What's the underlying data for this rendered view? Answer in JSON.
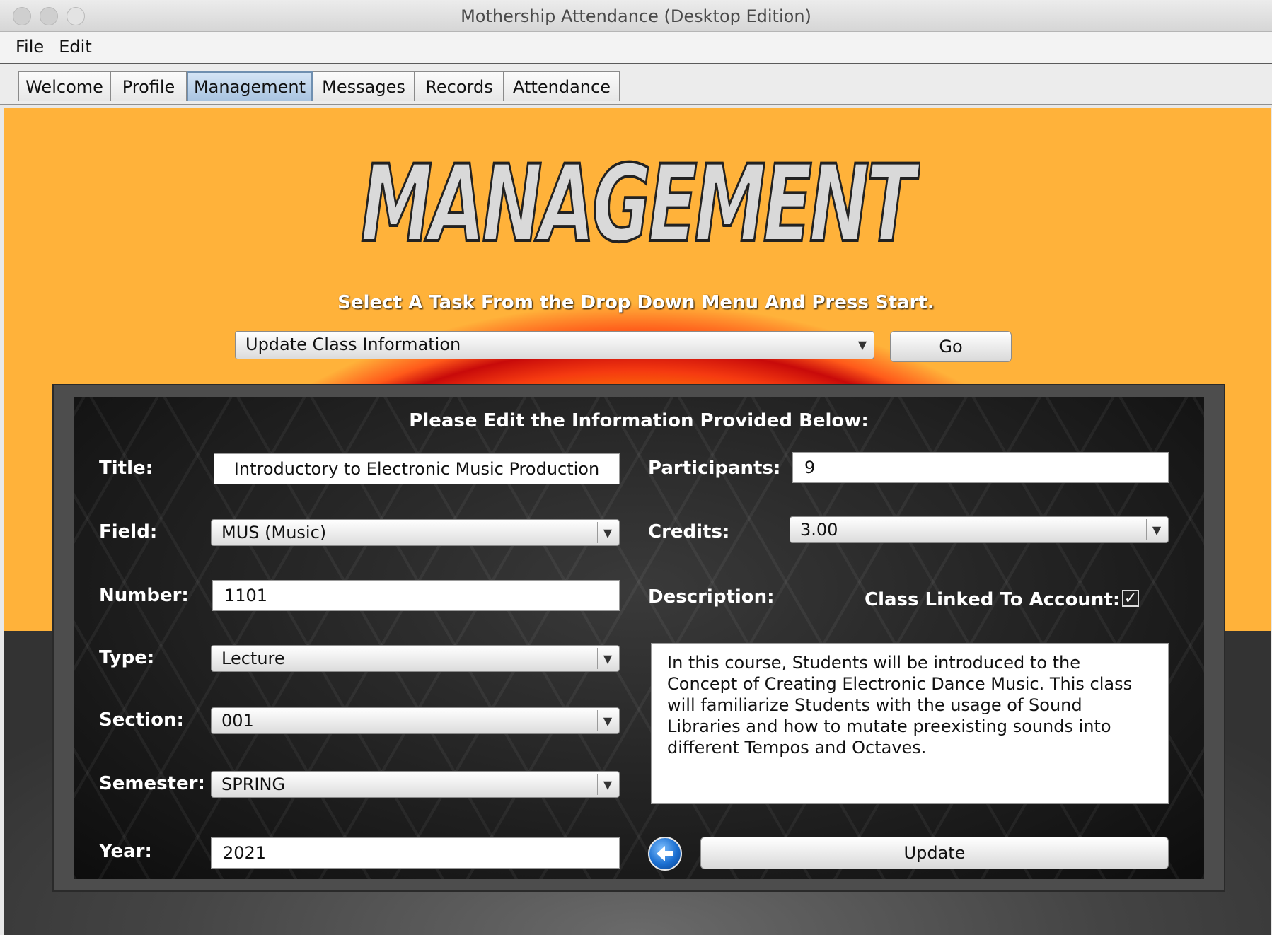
{
  "window": {
    "title": "Mothership Attendance (Desktop Edition)"
  },
  "menu": {
    "file": "File",
    "edit": "Edit"
  },
  "tabs": [
    "Welcome",
    "Profile",
    "Management",
    "Messages",
    "Records",
    "Attendance"
  ],
  "active_tab": "Management",
  "header": {
    "logo_text": "MANAGEMENT",
    "subtitle": "Select A Task From the Drop Down Menu And Press Start."
  },
  "task": {
    "selected": "Update Class Information",
    "go_label": "Go"
  },
  "form": {
    "heading": "Please Edit the Information Provided Below:",
    "labels": {
      "title": "Title:",
      "field": "Field:",
      "number": "Number:",
      "type": "Type:",
      "section": "Section:",
      "semester": "Semester:",
      "year": "Year:",
      "participants": "Participants:",
      "credits": "Credits:",
      "description": "Description:",
      "linked": "Class Linked To Account:"
    },
    "values": {
      "title": "Introductory to Electronic Music Production",
      "field": "MUS  (Music)",
      "number": "1101",
      "type": "Lecture",
      "section": "001",
      "semester": "SPRING",
      "year": "2021",
      "participants": "9",
      "credits": "3.00",
      "description": "In this course, Students will be introduced to the Concept of Creating Electronic Dance Music. This class will familiarize Students with the usage of Sound Libraries and how to mutate preexisting sounds into different Tempos and Octaves.",
      "linked": true
    },
    "update_label": "Update"
  },
  "icons": {
    "dropdown": "triangle-down",
    "back": "left-arrow-circle",
    "check": "checkmark"
  }
}
